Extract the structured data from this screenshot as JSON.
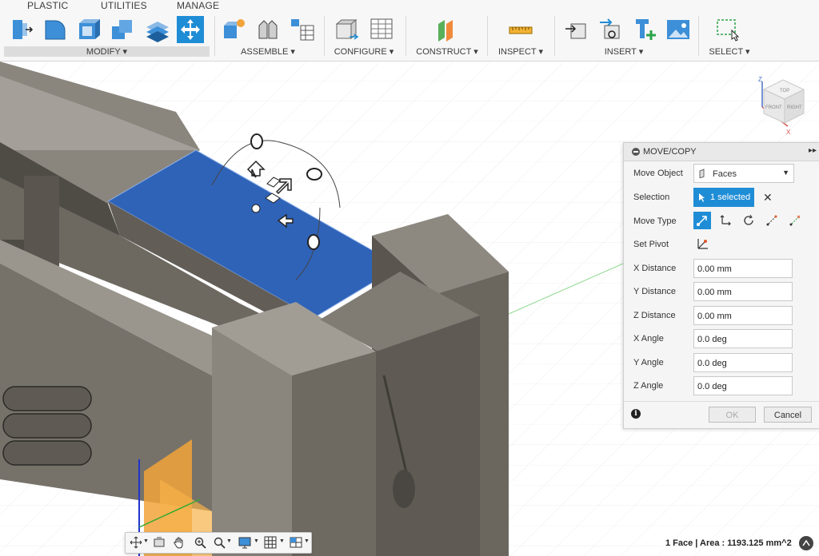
{
  "ribbon": {
    "tabs": [
      "PLASTIC",
      "UTILITIES",
      "MANAGE"
    ],
    "groups": [
      "MODIFY",
      "ASSEMBLE",
      "CONFIGURE",
      "CONSTRUCT",
      "INSPECT",
      "INSERT",
      "SELECT"
    ]
  },
  "panel": {
    "title": "MOVE/COPY",
    "move_object_label": "Move Object",
    "move_object_value": "Faces",
    "selection_label": "Selection",
    "selection_value": "1 selected",
    "move_type_label": "Move Type",
    "set_pivot_label": "Set Pivot",
    "x_distance_label": "X Distance",
    "x_distance_value": "0.00 mm",
    "y_distance_label": "Y Distance",
    "y_distance_value": "0.00 mm",
    "z_distance_label": "Z Distance",
    "z_distance_value": "0.00 mm",
    "x_angle_label": "X Angle",
    "x_angle_value": "0.0 deg",
    "y_angle_label": "Y Angle",
    "y_angle_value": "0.0 deg",
    "z_angle_label": "Z Angle",
    "z_angle_value": "0.0 deg",
    "ok_label": "OK",
    "cancel_label": "Cancel"
  },
  "viewcube": {
    "top": "TOP",
    "front": "FRONT",
    "right": "RIGHT",
    "axis_z": "Z",
    "axis_x": "X"
  },
  "status": {
    "text": "1 Face | Area : 1193.125 mm^2"
  },
  "colors": {
    "accent": "#1f8dd6",
    "selected_face": "#2f63b8",
    "body": "#6e6a62"
  }
}
